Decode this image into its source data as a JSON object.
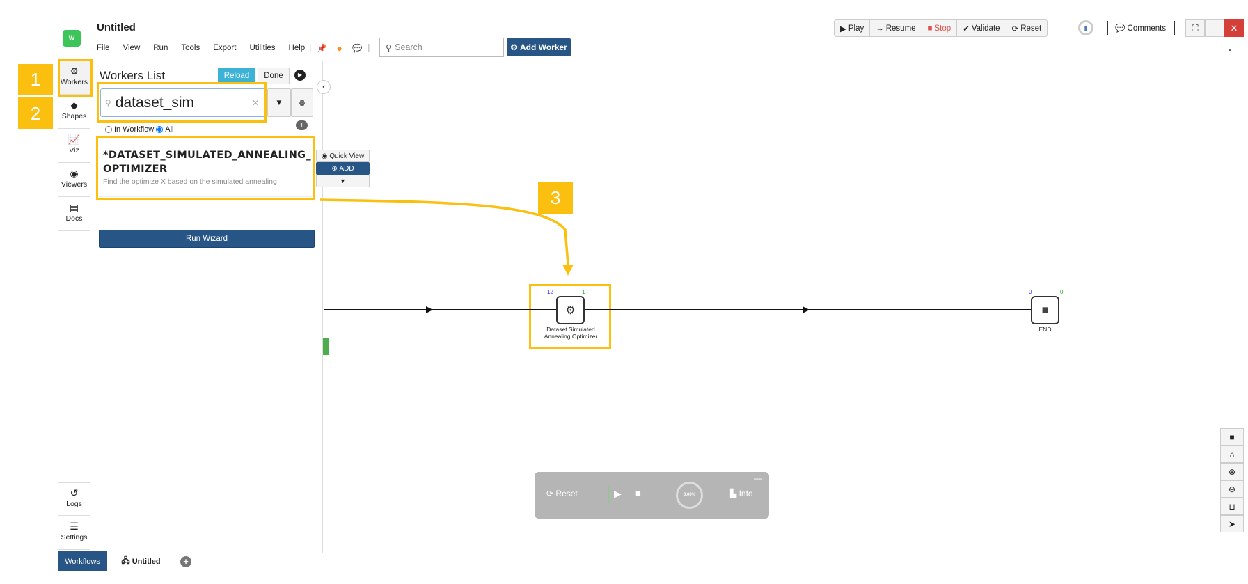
{
  "header": {
    "logo_text": "W",
    "title": "Untitled",
    "menu": [
      "File",
      "View",
      "Run",
      "Tools",
      "Export",
      "Utilities",
      "Help"
    ],
    "search_placeholder": "Search",
    "add_worker": "Add Worker"
  },
  "toolbar": {
    "play": "Play",
    "resume": "Resume",
    "stop": "Stop",
    "validate": "Validate",
    "reset": "Reset",
    "comments": "Comments"
  },
  "nav": {
    "items": [
      {
        "label": "Workers",
        "icon": "gear"
      },
      {
        "label": "Shapes",
        "icon": "diamond"
      },
      {
        "label": "Viz",
        "icon": "chart-line"
      },
      {
        "label": "Viewers",
        "icon": "eye"
      },
      {
        "label": "Docs",
        "icon": "file"
      }
    ],
    "bottom": [
      {
        "label": "Logs",
        "icon": "history"
      },
      {
        "label": "Settings",
        "icon": "sliders"
      }
    ]
  },
  "panel": {
    "title": "Workers List",
    "reload": "Reload",
    "done": "Done",
    "search_value": "dataset_sim",
    "count": "1",
    "filter_in_workflow": "In Workflow",
    "filter_all": "All",
    "worker": {
      "name": "*DATASET_SIMULATED_ANNEALING_OPTIMIZER",
      "description": "Find the optimize X based on the simulated annealing"
    },
    "quick_view": "Quick View",
    "add": "ADD",
    "run_wizard": "Run Wizard"
  },
  "annotations": [
    "1",
    "2",
    "3"
  ],
  "canvas": {
    "node": {
      "label": "Dataset Simulated Annealing Optimizer",
      "in_count": "12",
      "out_count": "1"
    },
    "end": {
      "label": "END",
      "in_count": "0",
      "out_count": "0"
    }
  },
  "runpanel": {
    "reset": "Reset",
    "progress": "0.00%",
    "info": "Info"
  },
  "bottom": {
    "workflows": "Workflows",
    "tab": "Untitled"
  },
  "colors": {
    "accent": "#275585",
    "highlight": "#fbbf10",
    "reload": "#3bb2d6",
    "stop": "#d9534f",
    "close": "#d43f3a"
  }
}
